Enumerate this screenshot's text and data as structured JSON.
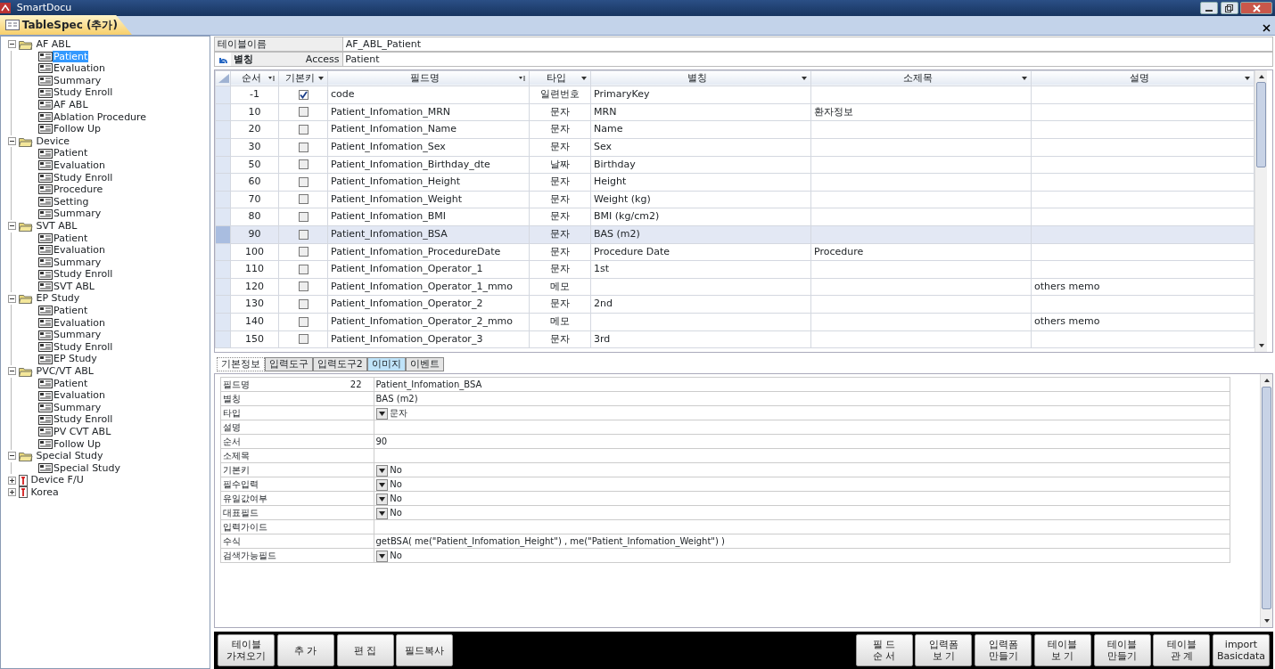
{
  "window": {
    "title": "SmartDocu"
  },
  "document_tab": {
    "label": "TableSpec (추가)"
  },
  "tree": [
    {
      "label": "AF ABL",
      "kind": "folder",
      "expanded": true,
      "selected": false,
      "children": [
        {
          "label": "Patient",
          "selected": true
        },
        {
          "label": "Evaluation",
          "selected": false
        },
        {
          "label": "Summary",
          "selected": false
        },
        {
          "label": "Study Enroll",
          "selected": false
        },
        {
          "label": "AF ABL",
          "selected": false
        },
        {
          "label": "Ablation Procedure",
          "selected": false
        },
        {
          "label": "Follow Up",
          "selected": false
        }
      ]
    },
    {
      "label": "Device",
      "kind": "folder",
      "expanded": true,
      "selected": false,
      "children": [
        {
          "label": "Patient",
          "selected": false
        },
        {
          "label": "Evaluation",
          "selected": false
        },
        {
          "label": "Study Enroll",
          "selected": false
        },
        {
          "label": "Procedure",
          "selected": false
        },
        {
          "label": "Setting",
          "selected": false
        },
        {
          "label": "Summary",
          "selected": false
        }
      ]
    },
    {
      "label": "SVT ABL",
      "kind": "folder",
      "expanded": true,
      "selected": false,
      "children": [
        {
          "label": "Patient",
          "selected": false
        },
        {
          "label": "Evaluation",
          "selected": false
        },
        {
          "label": "Summary",
          "selected": false
        },
        {
          "label": "Study Enroll",
          "selected": false
        },
        {
          "label": "SVT ABL",
          "selected": false
        }
      ]
    },
    {
      "label": "EP Study",
      "kind": "folder",
      "expanded": true,
      "selected": false,
      "children": [
        {
          "label": "Patient",
          "selected": false
        },
        {
          "label": "Evaluation",
          "selected": false
        },
        {
          "label": "Summary",
          "selected": false
        },
        {
          "label": "Study Enroll",
          "selected": false
        },
        {
          "label": "EP Study",
          "selected": false
        }
      ]
    },
    {
      "label": "PVC/VT ABL",
      "kind": "folder",
      "expanded": true,
      "selected": false,
      "children": [
        {
          "label": "Patient",
          "selected": false
        },
        {
          "label": "Evaluation",
          "selected": false
        },
        {
          "label": "Summary",
          "selected": false
        },
        {
          "label": "Study Enroll",
          "selected": false
        },
        {
          "label": "PV CVT ABL",
          "selected": false
        },
        {
          "label": "Follow Up",
          "selected": false
        }
      ]
    },
    {
      "label": "Special Study",
      "kind": "folder",
      "expanded": true,
      "selected": false,
      "children": [
        {
          "label": "Special Study",
          "selected": false
        }
      ]
    },
    {
      "label": "Device F/U",
      "kind": "table",
      "expanded": false,
      "selected": false
    },
    {
      "label": "Korea",
      "kind": "table",
      "expanded": false,
      "selected": false
    }
  ],
  "table_info": {
    "name_label": "테이블이름",
    "name_value": "AF_ABL_Patient",
    "alias_label": "별칭",
    "alias_source": "Access",
    "alias_value": "Patient"
  },
  "fields_grid": {
    "columns": [
      {
        "label": "순서",
        "sort": true
      },
      {
        "label": "기본키",
        "sort": false
      },
      {
        "label": "필드명",
        "sort": true
      },
      {
        "label": "타입",
        "sort": false
      },
      {
        "label": "별칭",
        "sort": false
      },
      {
        "label": "소제목",
        "sort": false
      },
      {
        "label": "설명",
        "sort": false
      }
    ],
    "rows": [
      {
        "order": "-1",
        "primary_key": true,
        "field_name": "code",
        "type": "일련번호",
        "alias": "PrimaryKey",
        "selected": false
      },
      {
        "order": "10",
        "primary_key": false,
        "field_name": "Patient_Infomation_MRN",
        "type": "문자",
        "alias": "MRN",
        "subtitle": "환자정보",
        "selected": false
      },
      {
        "order": "20",
        "primary_key": false,
        "field_name": "Patient_Infomation_Name",
        "type": "문자",
        "alias": "Name",
        "selected": false
      },
      {
        "order": "30",
        "primary_key": false,
        "field_name": "Patient_Infomation_Sex",
        "type": "문자",
        "alias": "Sex",
        "selected": false
      },
      {
        "order": "50",
        "primary_key": false,
        "field_name": "Patient_Infomation_Birthday_dte",
        "type": "날짜",
        "alias": "Birthday",
        "selected": false
      },
      {
        "order": "60",
        "primary_key": false,
        "field_name": "Patient_Infomation_Height",
        "type": "문자",
        "alias": "Height",
        "selected": false
      },
      {
        "order": "70",
        "primary_key": false,
        "field_name": "Patient_Infomation_Weight",
        "type": "문자",
        "alias": "Weight (kg)",
        "selected": false
      },
      {
        "order": "80",
        "primary_key": false,
        "field_name": "Patient_Infomation_BMI",
        "type": "문자",
        "alias": "BMI (kg/cm2)",
        "selected": false
      },
      {
        "order": "90",
        "primary_key": false,
        "field_name": "Patient_Infomation_BSA",
        "type": "문자",
        "alias": "BAS (m2)",
        "selected": true
      },
      {
        "order": "100",
        "primary_key": false,
        "field_name": "Patient_Infomation_ProcedureDate",
        "type": "문자",
        "alias": "Procedure Date",
        "subtitle": "Procedure",
        "selected": false
      },
      {
        "order": "110",
        "primary_key": false,
        "field_name": "Patient_Infomation_Operator_1",
        "type": "문자",
        "alias": "1st",
        "selected": false
      },
      {
        "order": "120",
        "primary_key": false,
        "field_name": "Patient_Infomation_Operator_1_mmo",
        "type": "메모",
        "description": "others memo",
        "selected": false
      },
      {
        "order": "130",
        "primary_key": false,
        "field_name": "Patient_Infomation_Operator_2",
        "type": "문자",
        "alias": "2nd",
        "selected": false
      },
      {
        "order": "140",
        "primary_key": false,
        "field_name": "Patient_Infomation_Operator_2_mmo",
        "type": "메모",
        "description": "others memo",
        "selected": false
      },
      {
        "order": "150",
        "primary_key": false,
        "field_name": "Patient_Infomation_Operator_3",
        "type": "문자",
        "alias": "3rd",
        "selected": false
      }
    ]
  },
  "detail_tabs": [
    {
      "label": "기본정보",
      "selected": true,
      "highlighted": false
    },
    {
      "label": "입력도구",
      "selected": false,
      "highlighted": false
    },
    {
      "label": "입력도구2",
      "selected": false,
      "highlighted": false
    },
    {
      "label": "이미지",
      "selected": false,
      "highlighted": true
    },
    {
      "label": "이벤트",
      "selected": false,
      "highlighted": false
    }
  ],
  "properties": [
    {
      "label": "필드명",
      "kind": "text",
      "count": "22",
      "value": "Patient_Infomation_BSA"
    },
    {
      "label": "별칭",
      "kind": "text",
      "value": "BAS (m2)"
    },
    {
      "label": "타입",
      "kind": "dropdown",
      "value": "문자"
    },
    {
      "label": "설명",
      "kind": "text"
    },
    {
      "label": "순서",
      "kind": "text",
      "value": "90"
    },
    {
      "label": "소제목",
      "kind": "text"
    },
    {
      "label": "기본키",
      "kind": "dropdown",
      "value": "No"
    },
    {
      "label": "필수입력",
      "kind": "dropdown",
      "value": "No"
    },
    {
      "label": "유일값여부",
      "kind": "dropdown",
      "value": "No"
    },
    {
      "label": "대표필드",
      "kind": "dropdown",
      "value": "No"
    },
    {
      "label": "입력가이드",
      "kind": "text"
    },
    {
      "label": "수식",
      "kind": "text",
      "value": "getBSA( me(\"Patient_Infomation_Height\") , me(\"Patient_Infomation_Weight\")  )"
    },
    {
      "label": "검색가능필드",
      "kind": "dropdown",
      "value": "No"
    }
  ],
  "toolbar_left": [
    "테이블\n가져오기",
    "추 가",
    "편 집",
    "필드복사"
  ],
  "toolbar_right": [
    "필 드\n순 서",
    "입력폼\n보 기",
    "입력폼\n만들기",
    "테이블\n보 기",
    "테이블\n만들기",
    "테이블\n관 계",
    "import\nBasicdata"
  ]
}
